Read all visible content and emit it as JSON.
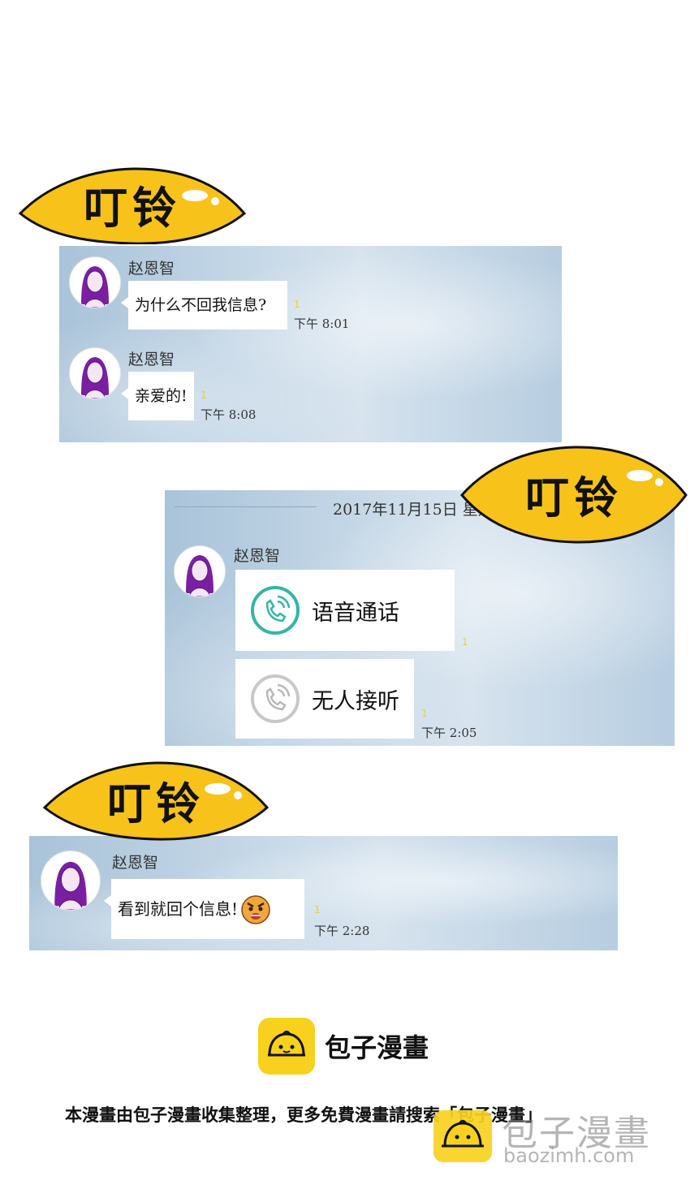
{
  "sound_effect": "叮铃",
  "panel1": {
    "messages": [
      {
        "sender": "赵恩智",
        "text": "为什么不回我信息?",
        "read_mark": "1",
        "time": "下午 8:01"
      },
      {
        "sender": "赵恩智",
        "text": "亲爱的!",
        "read_mark": "1",
        "time": "下午 8:08"
      }
    ]
  },
  "panel2": {
    "date": "2017年11月15日 星期",
    "sender": "赵恩智",
    "calls": [
      {
        "label": "语音通话",
        "status": "active",
        "read_mark": "1"
      },
      {
        "label": "无人接听",
        "status": "missed",
        "read_mark": "1",
        "time": "下午 2:05"
      }
    ]
  },
  "panel3": {
    "sender": "赵恩智",
    "text": "看到就回个信息!",
    "emoji": "angry-face-icon",
    "read_mark": "1",
    "time": "下午 2:28"
  },
  "footer": {
    "brand": "包子漫畫",
    "note": "本漫畫由包子漫畫收集整理，更多免費漫畫請搜索「包子漫畫」",
    "watermark_name": "包子漫畫",
    "watermark_url": "baozimh.com"
  },
  "colors": {
    "sfx_fill": "#f7c21a",
    "brand_yellow": "#f7d11e",
    "call_active": "#33b5a8",
    "call_missed": "#c8c8c8",
    "read_mark": "#e5d23a"
  }
}
